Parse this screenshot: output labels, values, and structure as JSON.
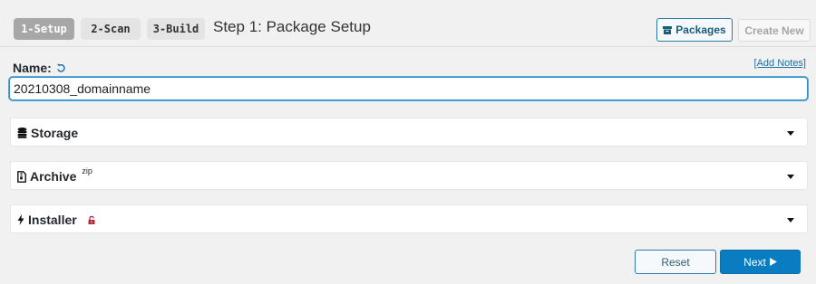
{
  "steps": [
    {
      "label": "1-Setup",
      "active": true
    },
    {
      "label": "2-Scan",
      "active": false
    },
    {
      "label": "3-Build",
      "active": false
    }
  ],
  "header": {
    "title": "Step 1: Package Setup",
    "packages_label": "Packages",
    "create_new_label": "Create New"
  },
  "name_field": {
    "label": "Name:",
    "value": "20210308_domainname",
    "add_notes_label": "[Add Notes]"
  },
  "panels": {
    "storage": {
      "title": "Storage",
      "icon": "database-icon"
    },
    "archive": {
      "title": "Archive",
      "sup": "zip",
      "icon": "file-archive-icon"
    },
    "installer": {
      "title": "Installer",
      "icon": "bolt-icon",
      "badge_icon": "unlock-icon"
    }
  },
  "footer": {
    "reset_label": "Reset",
    "next_label": "Next"
  },
  "colors": {
    "accent": "#0a7cc1",
    "active_step": "#a7a7a7",
    "unlock_icon": "#b3243b"
  }
}
